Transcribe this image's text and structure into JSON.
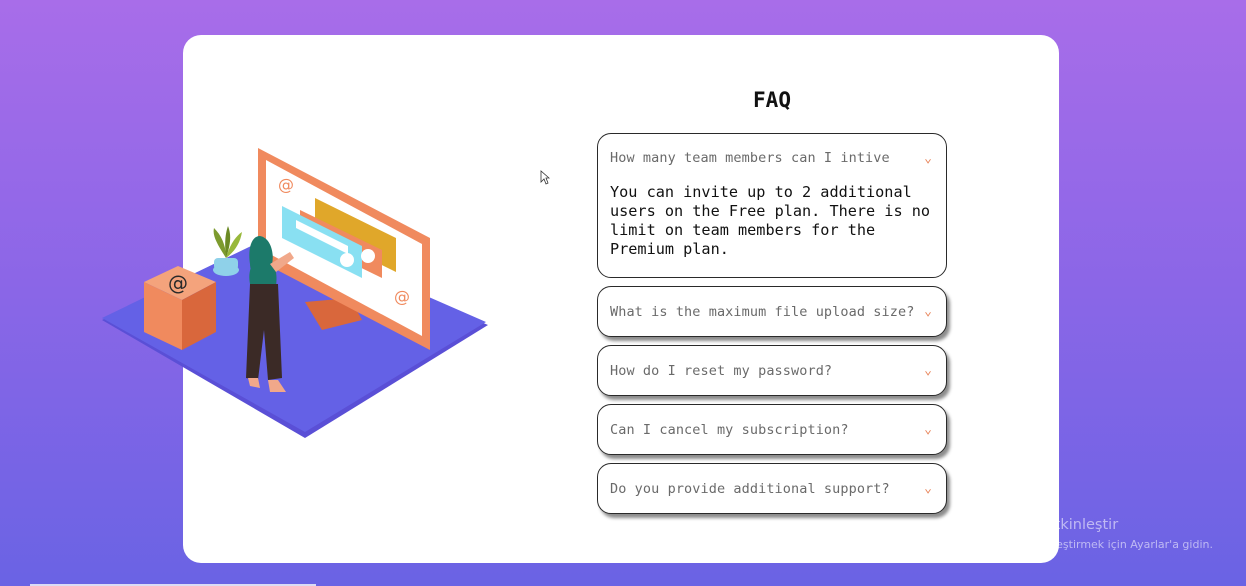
{
  "faq": {
    "title": "FAQ",
    "items": [
      {
        "question": "How many team members can I intive",
        "answer": "You can invite up to 2 additional users on the Free plan. There is no limit on team members for the Premium plan.",
        "expanded": true
      },
      {
        "question": "What is the maximum file upload size?",
        "answer": "",
        "expanded": false
      },
      {
        "question": "How do I reset my password?",
        "answer": "",
        "expanded": false
      },
      {
        "question": "Can I cancel my subscription?",
        "answer": "",
        "expanded": false
      },
      {
        "question": "Do you provide additional support?",
        "answer": "",
        "expanded": false
      }
    ],
    "chevron_icon": "chevron-down-icon",
    "accent_color": "#e8845a"
  },
  "illustration": {
    "icon_names": [
      "woman-at-screen-illustration",
      "at-sign-icon"
    ]
  },
  "colors": {
    "background_top": "#a86de9",
    "background_bottom": "#6a63e4",
    "card": "#ffffff",
    "platform": "#6461e6"
  },
  "watermark": {
    "title": "Windows'u Etkinleştir",
    "subtitle": "Windows'u etkinleştirmek için Ayarlar'a gidin."
  }
}
